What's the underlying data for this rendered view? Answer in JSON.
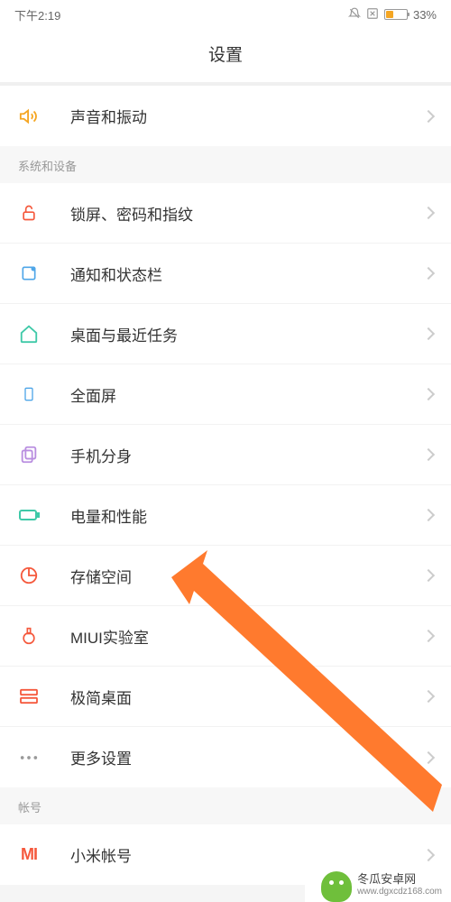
{
  "statusBar": {
    "time": "下午2:19",
    "batteryPercent": "33%"
  },
  "header": {
    "title": "设置"
  },
  "sections": {
    "top": {
      "items": [
        {
          "id": "sound",
          "label": "声音和振动",
          "icon": "volume-icon",
          "iconColor": "#f5a623"
        }
      ]
    },
    "system": {
      "title": "系统和设备",
      "items": [
        {
          "id": "lock",
          "label": "锁屏、密码和指纹",
          "icon": "lock-icon",
          "iconColor": "#f5593d"
        },
        {
          "id": "notif",
          "label": "通知和状态栏",
          "icon": "notification-icon",
          "iconColor": "#4fa6e8"
        },
        {
          "id": "desktop",
          "label": "桌面与最近任务",
          "icon": "home-icon",
          "iconColor": "#3fc9a8"
        },
        {
          "id": "full",
          "label": "全面屏",
          "icon": "phone-icon",
          "iconColor": "#4fa6e8"
        },
        {
          "id": "clone",
          "label": "手机分身",
          "icon": "clone-icon",
          "iconColor": "#b98ee0"
        },
        {
          "id": "battery",
          "label": "电量和性能",
          "icon": "battery-icon",
          "iconColor": "#3fc9a8"
        },
        {
          "id": "storage",
          "label": "存储空间",
          "icon": "storage-icon",
          "iconColor": "#f5593d"
        },
        {
          "id": "miui",
          "label": "MIUI实验室",
          "icon": "flask-icon",
          "iconColor": "#f5593d"
        },
        {
          "id": "simple",
          "label": "极简桌面",
          "icon": "grid-icon",
          "iconColor": "#f5593d"
        },
        {
          "id": "more",
          "label": "更多设置",
          "icon": "more-icon",
          "iconColor": "#999999"
        }
      ]
    },
    "account": {
      "title": "帐号",
      "items": [
        {
          "id": "miaccount",
          "label": "小米帐号",
          "icon": "mi-icon",
          "iconColor": "#f5593d"
        }
      ]
    }
  },
  "annotation": {
    "arrowColor": "#ff7a2e"
  },
  "watermark": {
    "line1": "冬瓜安卓网",
    "line2": "www.dgxcdz168.com"
  }
}
